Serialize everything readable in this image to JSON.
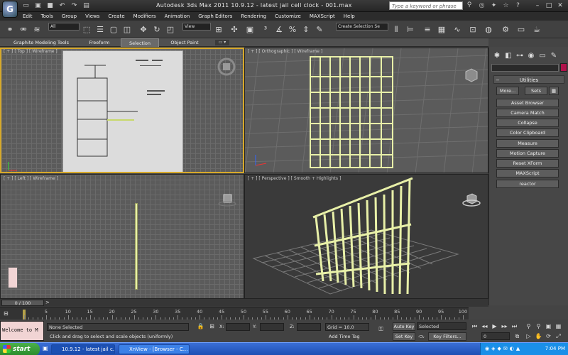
{
  "title_bar": {
    "app_title": "Autodesk 3ds Max  2011      10.9.12 - latest jail cell clock - 001.max",
    "search_placeholder": "Type a keyword or phrase"
  },
  "menu": [
    "Edit",
    "Tools",
    "Group",
    "Views",
    "Create",
    "Modifiers",
    "Animation",
    "Graph Editors",
    "Rendering",
    "Customize",
    "MAXScript",
    "Help"
  ],
  "toolbar": {
    "selection_filter": "All",
    "reference_coord": "View",
    "named_selection": "Create Selection Se"
  },
  "ribbon": {
    "tabs": [
      "Graphite Modeling Tools",
      "Freeform",
      "Selection",
      "Object Paint"
    ],
    "active_tab": "Selection"
  },
  "viewports": {
    "top": "[ + ] [ Top ] [ Wireframe ]",
    "orthographic": "[ + ] [ Orthographic ] [ Wireframe ]",
    "left": "[ + ] [ Left ] [ Wireframe ]",
    "perspective": "[ + ] [ Perspective ] [ Smooth + Highlights ]"
  },
  "command_panel": {
    "rollout_title": "Utilities",
    "more_label": "More...",
    "sets_label": "Sets",
    "utilities": [
      "Asset Browser",
      "Camera Match",
      "Collapse",
      "Color Clipboard",
      "Measure",
      "Motion Capture",
      "Reset XForm",
      "MAXScript",
      "reactor"
    ]
  },
  "timeline": {
    "frame_display": "0 / 100",
    "ticks": [
      "5",
      "10",
      "15",
      "20",
      "25",
      "30",
      "35",
      "40",
      "45",
      "50",
      "55",
      "60",
      "65",
      "70",
      "75",
      "80",
      "85",
      "90",
      "95",
      "100"
    ]
  },
  "status": {
    "maxscript_listener": "Welcome to M",
    "selection_info": "None Selected",
    "prompt": "Click and drag to select and scale objects (uniformly)",
    "x_label": "X:",
    "y_label": "Y:",
    "z_label": "Z:",
    "grid": "Grid = 10.0",
    "add_time_tag": "Add Time Tag",
    "auto_key": "Auto Key",
    "set_key": "Set Key",
    "key_mode_value": "Selected",
    "key_filters": "Key Filters...",
    "current_frame": "0"
  },
  "taskbar": {
    "start": "start",
    "tasks": [
      "10.9.12 - latest jail c...",
      "XnView - [Browser - C..."
    ],
    "clock": "7:04 PM"
  },
  "colors": {
    "viewport_bg": "#5b5b5b",
    "active_border": "#d7a92a",
    "geometry": "#e8f0a8",
    "object_color_swatch": "#b0114a"
  }
}
